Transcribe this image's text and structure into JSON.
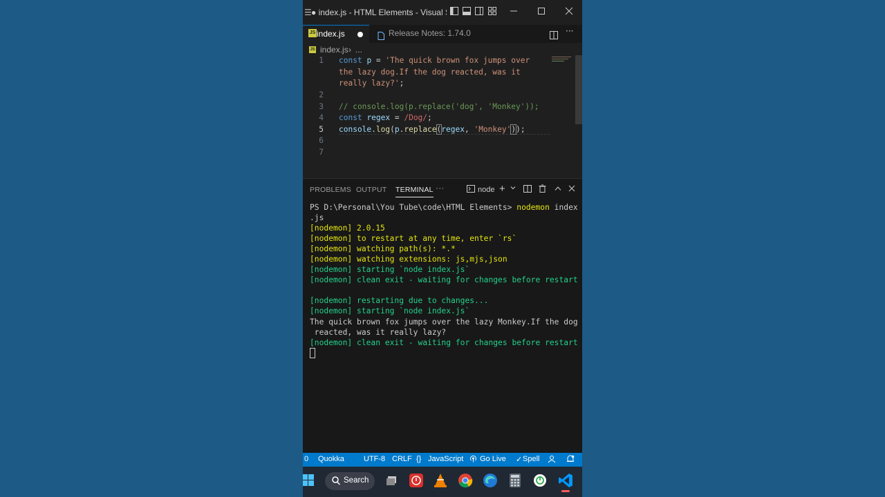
{
  "titlebar": {
    "title": "● index.js - HTML Elements - Visual Studi...",
    "menu_icon": "hamburger-icon",
    "controls": [
      "minimize-icon",
      "maximize-icon",
      "close-icon"
    ]
  },
  "tabs": [
    {
      "label": "index.js",
      "icon": "js-file-icon",
      "modified": true
    },
    {
      "label": "Release Notes: 1.74.0",
      "icon": "document-icon"
    }
  ],
  "breadcrumbs": {
    "file": "index.js",
    "sep": "›",
    "more": "..."
  },
  "editor": {
    "lines": [
      {
        "num": "1"
      },
      {
        "num": ""
      },
      {
        "num": ""
      },
      {
        "num": "2"
      },
      {
        "num": "3"
      },
      {
        "num": "4"
      },
      {
        "num": "5"
      },
      {
        "num": "6"
      },
      {
        "num": "7"
      }
    ],
    "code": {
      "l1a": "const",
      "l1b": "p",
      "l1c": " = ",
      "l1d": "'The quick brown fox jumps over",
      "l1e": "the lazy dog.If the dog reacted, was it",
      "l1f": "really lazy?'",
      "l1g": ";",
      "l3": "// console.log(p.replace('dog', 'Monkey'));",
      "l4a": "const",
      "l4b": "regex",
      "l4c": " = ",
      "l4d": "/Dog/",
      "l4e": ";",
      "l5a": "console",
      "l5b": ".",
      "l5c": "log",
      "l5d": "(",
      "l5e": "p",
      "l5f": ".",
      "l5g": "replace",
      "l5h": "(",
      "l5i": "regex",
      "l5j": ", ",
      "l5k": "'Monkey'",
      "l5l": ")",
      "l5m": ");"
    }
  },
  "panel": {
    "tabs": [
      "PROBLEMS",
      "OUTPUT",
      "TERMINAL"
    ],
    "active_tab": "TERMINAL",
    "more": "···",
    "shell": "node",
    "terminal_lines": [
      {
        "text": "PS D:\\Personal\\You Tube\\code\\HTML Elements> ",
        "color": "white",
        "suffix": "nodemon",
        "suffix_color": "yellow",
        "rest": " index"
      },
      {
        "text": ".js",
        "color": "white"
      },
      {
        "text": "[nodemon] 2.0.15",
        "color": "yellow"
      },
      {
        "text": "[nodemon] to restart at any time, enter `rs`",
        "color": "yellow"
      },
      {
        "text": "[nodemon] watching path(s): *.*",
        "color": "yellow"
      },
      {
        "text": "[nodemon] watching extensions: js,mjs,json",
        "color": "yellow"
      },
      {
        "text": "[nodemon] starting `node index.js`",
        "color": "green"
      },
      {
        "text": "[nodemon] clean exit - waiting for changes before restart",
        "color": "green"
      },
      {
        "text": "",
        "color": "white"
      },
      {
        "text": "[nodemon] restarting due to changes...",
        "color": "green"
      },
      {
        "text": "[nodemon] starting `node index.js`",
        "color": "green"
      },
      {
        "text": "The quick brown fox jumps over the lazy Monkey.If the dog",
        "color": "white"
      },
      {
        "text": " reacted, was it really lazy?",
        "color": "white"
      },
      {
        "text": "[nodemon] clean exit - waiting for changes before restart",
        "color": "green"
      }
    ]
  },
  "statusbar": {
    "left_num": "0",
    "quokka": "Quokka",
    "encoding": "UTF-8",
    "eol": "CRLF",
    "lang_icon": "{}",
    "language": "JavaScript",
    "golive": "Go Live",
    "spell": "Spell"
  },
  "taskbar": {
    "search_label": "Search",
    "apps": [
      "windows-start-icon",
      "task-view-icon",
      "app-red-icon",
      "vlc-icon",
      "chrome-icon",
      "edge-icon",
      "calculator-icon",
      "power-app-icon",
      "vscode-icon"
    ]
  },
  "colors": {
    "background": "#1d5a85",
    "statusbar": "#007acc",
    "editor_bg": "#1f1f1f"
  }
}
